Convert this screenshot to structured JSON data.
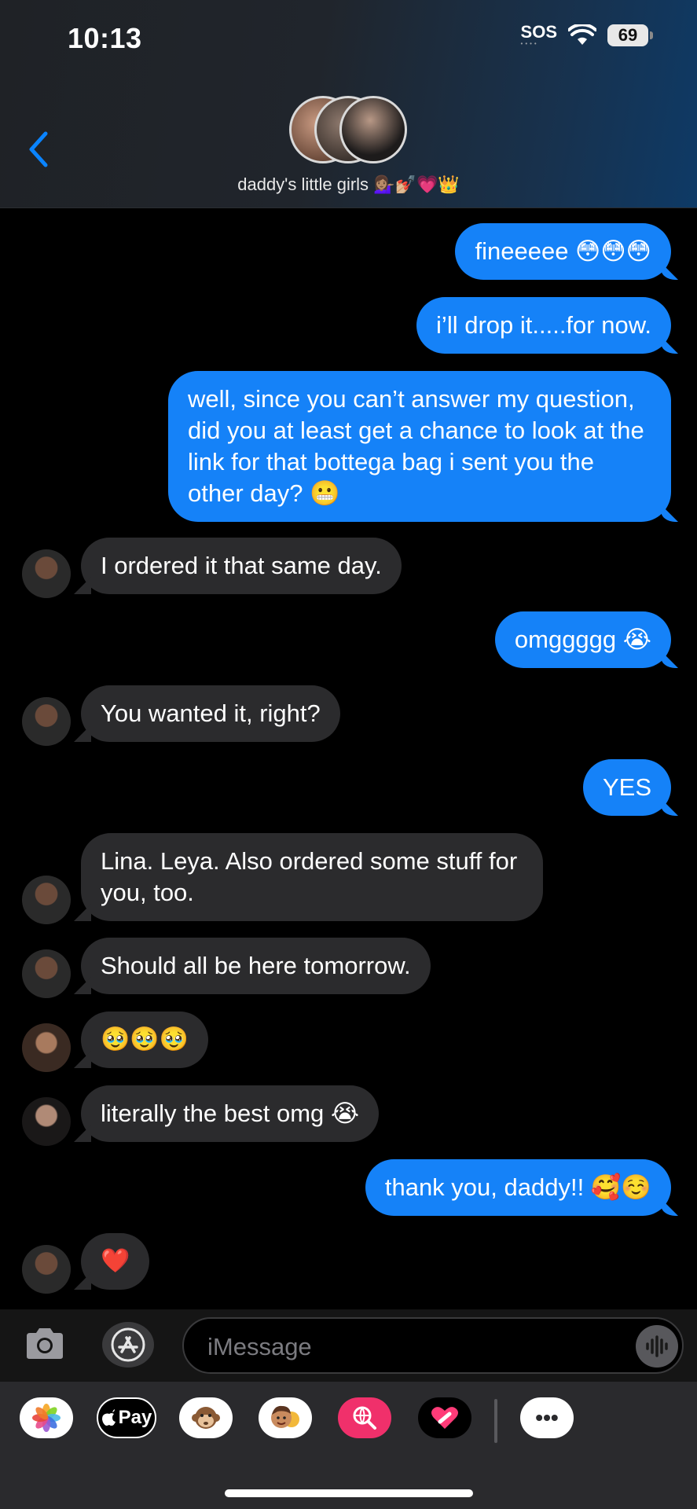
{
  "status_bar": {
    "time": "10:13",
    "sos": "SOS",
    "battery": "69"
  },
  "header": {
    "group_name": "daddy's little girls",
    "group_emojis": "💁🏽‍♀️💅🏼💗👑"
  },
  "messages": [
    {
      "from": "me",
      "text": "fineeeee 😳😳😳"
    },
    {
      "from": "me",
      "text": "i’ll drop it.....for now."
    },
    {
      "from": "me",
      "text": "well, since you can’t answer my question, did you at least get a chance to look at the link for that bottega bag i sent you the other day? 😬"
    },
    {
      "from": "daddy",
      "text": "I ordered it that same day."
    },
    {
      "from": "me",
      "text": "omggggg 😭"
    },
    {
      "from": "daddy",
      "text": "You wanted it, right?"
    },
    {
      "from": "me",
      "text": "YES"
    },
    {
      "from": "daddy",
      "text": "Lina. Leya. Also ordered some stuff for you, too."
    },
    {
      "from": "daddy",
      "text": "Should all be here tomorrow."
    },
    {
      "from": "girl_1",
      "text": "🥹🥹🥹"
    },
    {
      "from": "girl_2",
      "text": "literally the best omg 😭"
    },
    {
      "from": "me",
      "text": "thank you, daddy!! 🥰☺️"
    },
    {
      "from": "daddy",
      "text": "❤️"
    }
  ],
  "composer": {
    "placeholder": "iMessage"
  },
  "app_strip": {
    "apple_pay_label": "Pay",
    "more_label": "•••"
  },
  "colors": {
    "sent_bubble": "#1582f8",
    "received_bubble": "#2b2b2d",
    "accent": "#0a84ff"
  }
}
